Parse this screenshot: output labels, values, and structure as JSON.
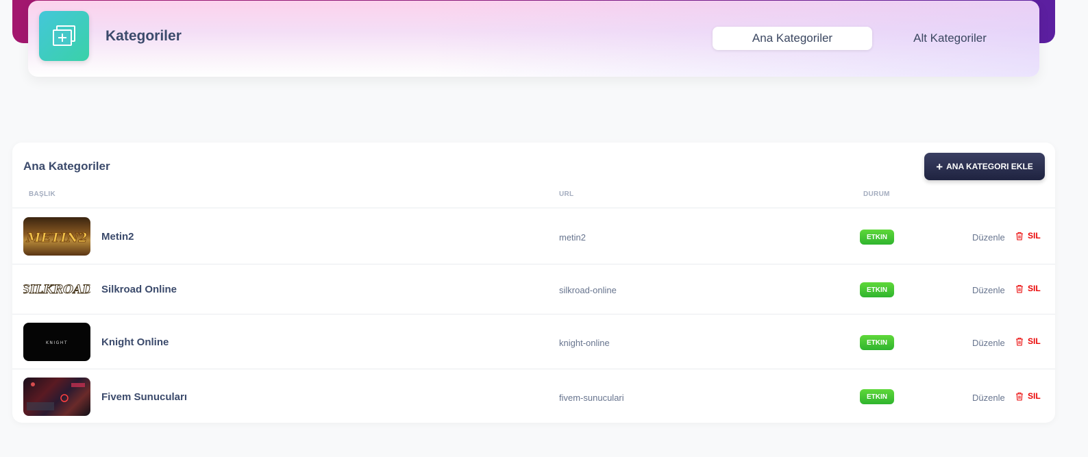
{
  "header": {
    "title": "Kategoriler",
    "tabs": [
      {
        "label": "Ana Kategoriler",
        "active": true
      },
      {
        "label": "Alt Kategoriler",
        "active": false
      }
    ]
  },
  "card": {
    "title": "Ana Kategoriler",
    "add_button": "ANA KATEGORI EKLE",
    "columns": {
      "title": "BAŞLIK",
      "url": "URL",
      "status": "DURUM"
    },
    "rows": [
      {
        "name": "Metin2",
        "url": "metin2",
        "status": "ETKIN",
        "edit": "Düzenle",
        "delete": "SIL",
        "thumb_text": "METIN2"
      },
      {
        "name": "Silkroad Online",
        "url": "silkroad-online",
        "status": "ETKIN",
        "edit": "Düzenle",
        "delete": "SIL",
        "thumb_text": "SILKROAD"
      },
      {
        "name": "Knight Online",
        "url": "knight-online",
        "status": "ETKIN",
        "edit": "Düzenle",
        "delete": "SIL",
        "thumb_text": "KNIGHT"
      },
      {
        "name": "Fivem Sunucuları",
        "url": "fivem-sunuculari",
        "status": "ETKIN",
        "edit": "Düzenle",
        "delete": "SIL",
        "thumb_text": ""
      }
    ]
  },
  "colors": {
    "accent": "#1f2340",
    "success": "#2fb42e",
    "danger": "#ea0606"
  }
}
